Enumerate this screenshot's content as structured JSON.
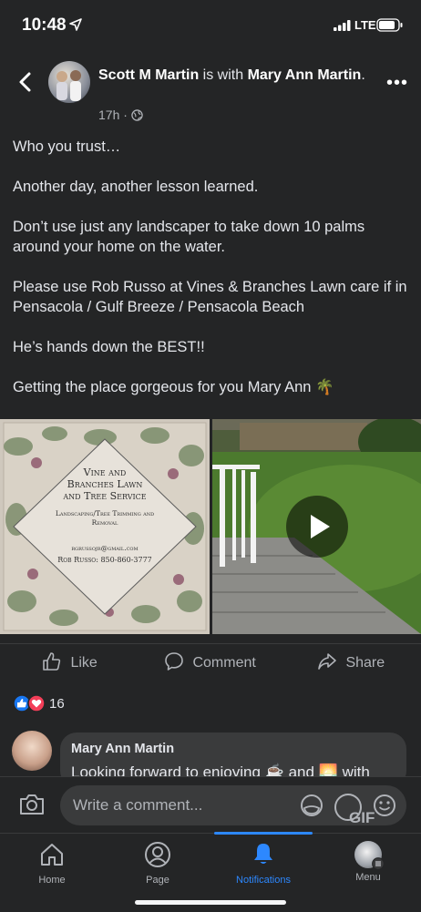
{
  "status_bar": {
    "time": "10:48",
    "network": "LTE"
  },
  "post_header": {
    "author": "Scott M Martin",
    "with_text": "is with",
    "tagged": "Mary Ann Martin",
    "period": ".",
    "time_ago": "17h",
    "sep": "·",
    "more_label": "•••"
  },
  "post_text": [
    "Who you trust…",
    "Another day, another lesson learned.",
    "Don’t use just any landscaper to take down 10 palms around your home on the water.",
    "Please use Rob Russo at Vines & Branches Lawn care if in Pensacola / Gulf Breeze / Pensacola Beach",
    "He’s hands down the BEST!!",
    "Getting the place gorgeous for you Mary Ann 🌴"
  ],
  "business_card": {
    "line1": "Vine and",
    "line2": "Branches Lawn",
    "line3": "and Tree Service",
    "line4": "Landscaping/Tree Trimming and",
    "line5": "Removal",
    "email": "rgrussojr@gmail.com",
    "phone": "Rob Russo: 850-860-3777"
  },
  "actions": {
    "like": "Like",
    "comment": "Comment",
    "share": "Share"
  },
  "reactions": {
    "count": "16"
  },
  "comment": {
    "name": "Mary Ann Martin",
    "text_start": "Looking forward to enjoying",
    "text_mid": "and",
    "text_end": "with"
  },
  "composer": {
    "placeholder": "Write a comment...",
    "gif_label": "GIF"
  },
  "tabs": [
    {
      "label": "Home"
    },
    {
      "label": "Page"
    },
    {
      "label": "Notifications"
    },
    {
      "label": "Menu"
    }
  ],
  "colors": {
    "accent": "#2d88ff",
    "background": "#242526",
    "like": "#1877f2",
    "love": "#f33e58"
  }
}
